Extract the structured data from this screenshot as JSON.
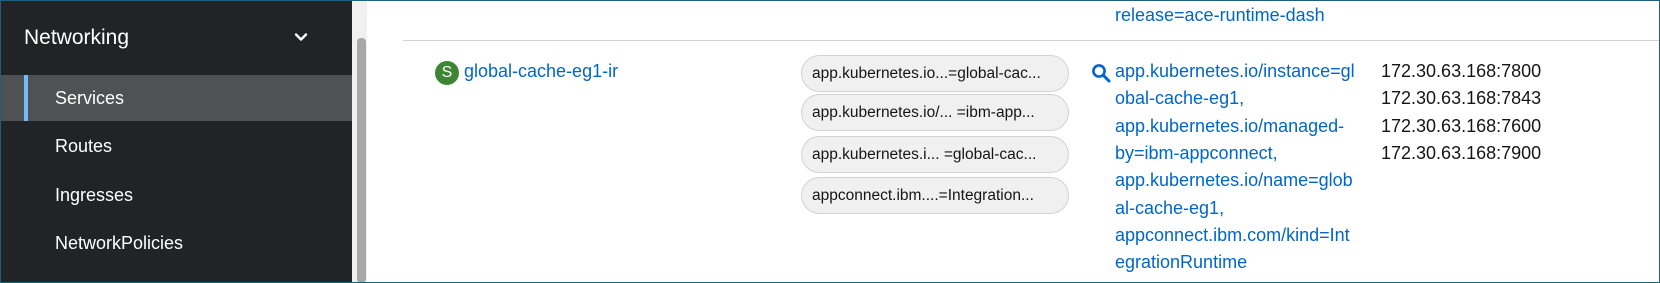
{
  "sidebar": {
    "section_title": "Networking",
    "items": [
      {
        "label": "Services",
        "active": true
      },
      {
        "label": "Routes",
        "active": false
      },
      {
        "label": "Ingresses",
        "active": false
      },
      {
        "label": "NetworkPolicies",
        "active": false
      }
    ]
  },
  "table": {
    "previous_row_selector_tail": "release=ace-runtime-dash",
    "row": {
      "name_badge": "S",
      "name": "global-cache-eg1-ir",
      "labels": [
        "app.kubernetes.io...=global-cac...",
        "app.kubernetes.io/... =ibm-app...",
        "app.kubernetes.i... =global-cac...",
        "appconnect.ibm....=Integration..."
      ],
      "selector_lines": [
        "app.kubernetes.io/instance=gl",
        "obal-cache-eg1,",
        "app.kubernetes.io/managed-",
        "by=ibm-appconnect,",
        "app.kubernetes.io/name=glob",
        "al-cache-eg1,",
        "appconnect.ibm.com/kind=Int",
        "egrationRuntime"
      ],
      "endpoints": [
        "172.30.63.168:7800",
        "172.30.63.168:7843",
        "172.30.63.168:7600",
        "172.30.63.168:7900"
      ]
    }
  },
  "colors": {
    "sidebar_bg": "#212427",
    "active_item_bg": "#4f5255",
    "active_indicator": "#73bcf7",
    "link": "#0066cc",
    "service_badge": "#3e8635"
  },
  "icons": {
    "section_toggle": "chevron-down-icon",
    "selector_search": "search-icon"
  }
}
